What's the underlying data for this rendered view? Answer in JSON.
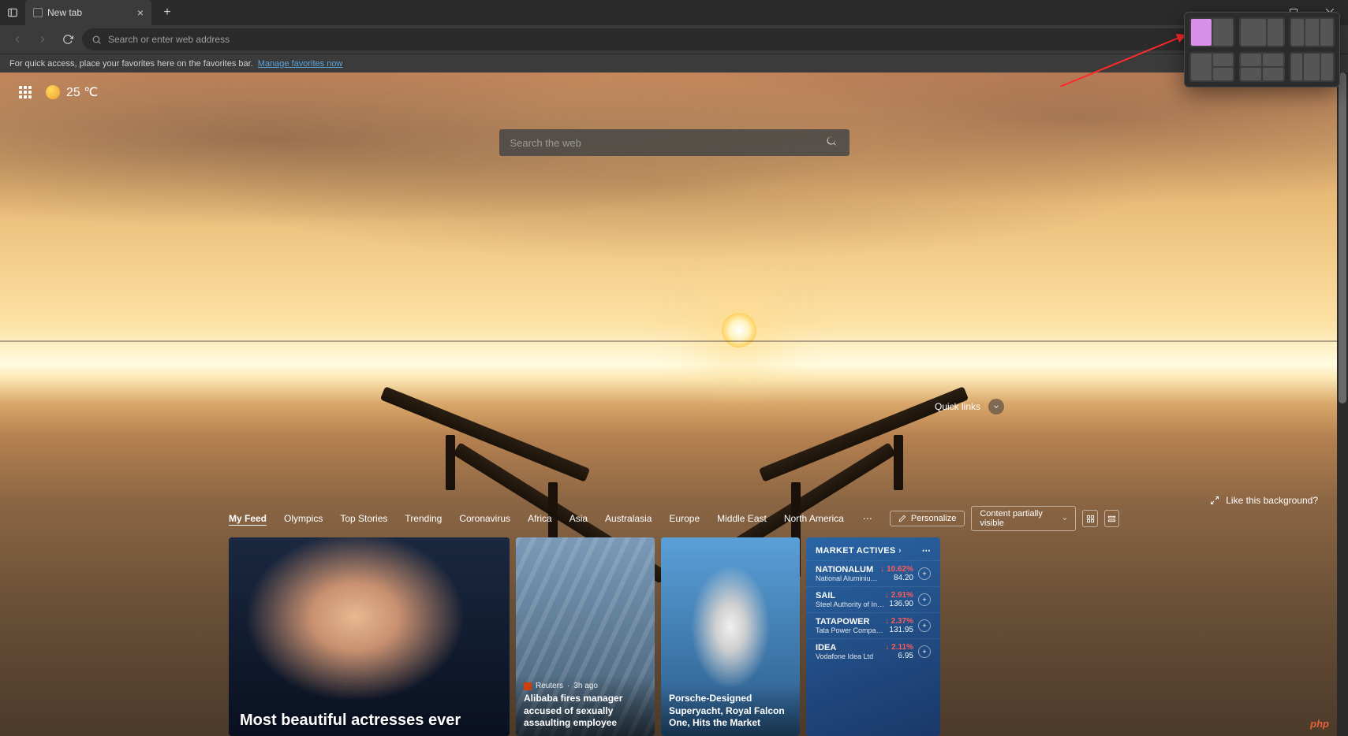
{
  "tab": {
    "title": "New tab"
  },
  "addressbar": {
    "placeholder": "Search or enter web address"
  },
  "favorites_bar": {
    "message": "For quick access, place your favorites here on the favorites bar.",
    "link": "Manage favorites now"
  },
  "weather": {
    "temp": "25 ℃"
  },
  "search": {
    "placeholder": "Search the web"
  },
  "quicklinks": {
    "label": "Quick links"
  },
  "like_bg": {
    "label": "Like this background?"
  },
  "feed_nav": [
    "My Feed",
    "Olympics",
    "Top Stories",
    "Trending",
    "Coronavirus",
    "Africa",
    "Asia",
    "Australasia",
    "Europe",
    "Middle East",
    "North America"
  ],
  "feed_controls": {
    "personalize": "Personalize",
    "visibility": "Content partially visible"
  },
  "cards": {
    "c1": {
      "title": "Most beautiful actresses ever"
    },
    "c2": {
      "source": "Reuters",
      "time": "3h ago",
      "title": "Alibaba fires manager accused of sexually assaulting employee"
    },
    "c3": {
      "title": "Porsche-Designed Superyacht, Royal Falcon One, Hits the Market"
    }
  },
  "market": {
    "header": "MARKET ACTIVES",
    "rows": [
      {
        "sym": "NATIONALUM",
        "sub": "National Aluminium Co Ltd",
        "pct": "↓ 10.62%",
        "val": "84.20"
      },
      {
        "sym": "SAIL",
        "sub": "Steel Authority of India Ltd",
        "pct": "↓ 2.91%",
        "val": "136.90"
      },
      {
        "sym": "TATAPOWER",
        "sub": "Tata Power Company Ltd",
        "pct": "↓ 2.37%",
        "val": "131.95"
      },
      {
        "sym": "IDEA",
        "sub": "Vodafone Idea Ltd",
        "pct": "↓ 2.11%",
        "val": "6.95"
      }
    ]
  },
  "watermark": "php"
}
